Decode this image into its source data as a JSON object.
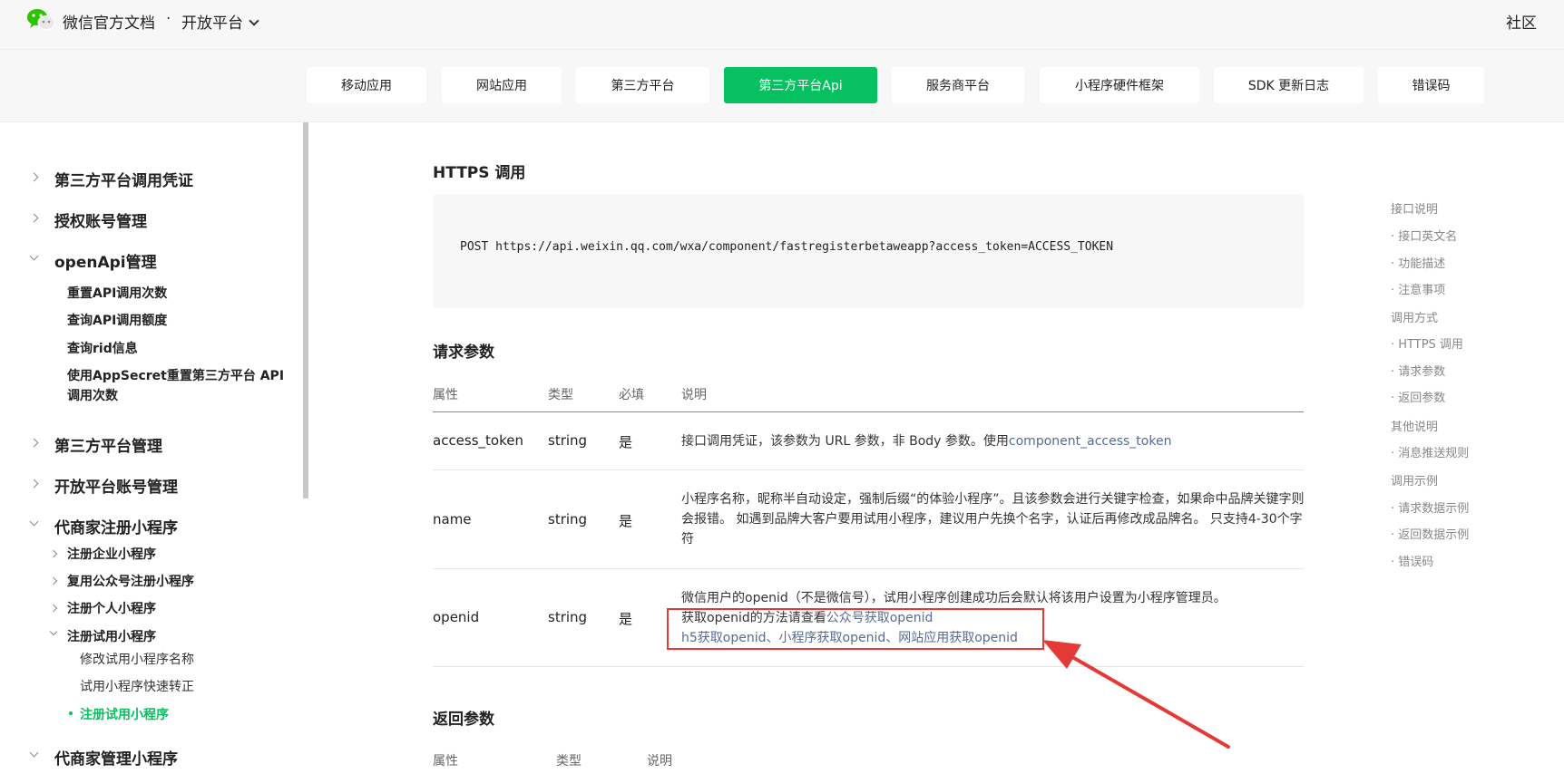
{
  "header": {
    "site_title": "微信官方文档",
    "separator": "·",
    "platform_menu": "开放平台",
    "community": "社区"
  },
  "tabs": [
    {
      "label": "移动应用"
    },
    {
      "label": "网站应用"
    },
    {
      "label": "第三方平台"
    },
    {
      "label": "第三方平台Api",
      "active": true
    },
    {
      "label": "服务商平台"
    },
    {
      "label": "小程序硬件框架"
    },
    {
      "label": "SDK 更新日志"
    },
    {
      "label": "错误码"
    }
  ],
  "sidebar": {
    "items": [
      {
        "label": "第三方平台调用凭证"
      },
      {
        "label": "授权账号管理"
      },
      {
        "label": "openApi管理"
      },
      {
        "label": "重置API调用次数"
      },
      {
        "label": "查询API调用额度"
      },
      {
        "label": "查询rid信息"
      },
      {
        "label": "使用AppSecret重置第三方平台 API"
      },
      {
        "label": "调用次数"
      },
      {
        "label": "第三方平台管理"
      },
      {
        "label": "开放平台账号管理"
      },
      {
        "label": "代商家注册小程序"
      },
      {
        "label": "注册企业小程序"
      },
      {
        "label": "复用公众号注册小程序"
      },
      {
        "label": "注册个人小程序"
      },
      {
        "label": "注册试用小程序"
      },
      {
        "label": "修改试用小程序名称"
      },
      {
        "label": "试用小程序快速转正"
      },
      {
        "label": "注册试用小程序"
      },
      {
        "label": "代商家管理小程序"
      }
    ]
  },
  "main": {
    "https_heading": "HTTPS 调用",
    "code": "POST https://api.weixin.qq.com/wxa/component/fastregisterbetaweapp?access_token=ACCESS_TOKEN",
    "request_heading": "请求参数",
    "request_headers": [
      "属性",
      "类型",
      "必填",
      "说明"
    ],
    "request_rows": [
      {
        "name": "access_token",
        "type": "string",
        "required": "是",
        "desc_text": "接口调用凭证，该参数为 URL 参数，非 Body 参数。使用",
        "desc_link": "component_access_token"
      },
      {
        "name": "name",
        "type": "string",
        "required": "是",
        "desc_line1": "小程序名称，昵称半自动设定，强制后缀“的体验小程序”。且该参数会进行关键字检查，如果命中品牌关键字则",
        "desc_line2": "会报错。 如遇到品牌大客户要用试用小程序，建议用户先换个名字，认证后再修改成品牌名。 只支持4-30个字",
        "desc_line3": "符"
      },
      {
        "name": "openid",
        "type": "string",
        "required": "是",
        "desc_line1": "微信用户的openid（不是微信号），试用小程序创建成功后会默认将该用户设置为小程序管理员。",
        "desc_line2_text": "获取openid的方法请查看",
        "desc_line2_link": "公众号获取openid",
        "desc_line3_link1": "h5获取openid",
        "desc_line3_sep1": "、",
        "desc_line3_link2": "小程序获取openid",
        "desc_line3_sep2": "、",
        "desc_line3_link3": "网站应用获取openid"
      }
    ],
    "response_heading": "返回参数",
    "response_headers": [
      "属性",
      "类型",
      "说明"
    ]
  },
  "toc": {
    "items": [
      {
        "label": "接口说明"
      },
      {
        "label": "· 接口英文名"
      },
      {
        "label": "· 功能描述"
      },
      {
        "label": "· 注意事项"
      },
      {
        "label": "调用方式"
      },
      {
        "label": "· HTTPS 调用"
      },
      {
        "label": "· 请求参数"
      },
      {
        "label": "· 返回参数"
      },
      {
        "label": "其他说明"
      },
      {
        "label": "· 消息推送规则"
      },
      {
        "label": "调用示例"
      },
      {
        "label": "· 请求数据示例"
      },
      {
        "label": "· 返回数据示例"
      },
      {
        "label": "· 错误码"
      }
    ]
  },
  "colors": {
    "brand_green": "#07c160",
    "link": "#576b95",
    "annotation_red": "#e53935"
  }
}
